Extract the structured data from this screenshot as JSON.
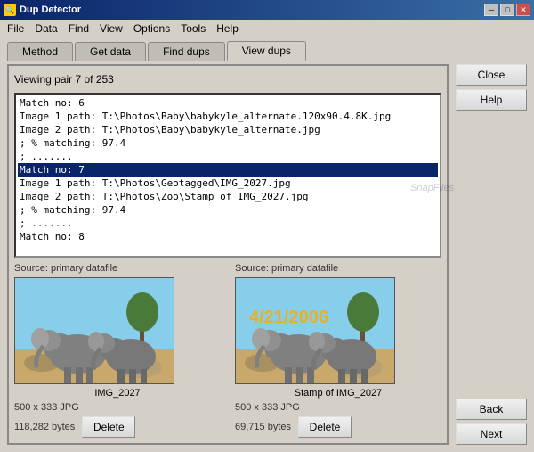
{
  "titleBar": {
    "title": "Dup Detector",
    "icon": "DD",
    "buttons": [
      "minimize",
      "maximize",
      "close"
    ]
  },
  "menuBar": {
    "items": [
      "File",
      "Data",
      "Find",
      "View",
      "Options",
      "Tools",
      "Help"
    ]
  },
  "tabs": [
    {
      "label": "Method",
      "active": false
    },
    {
      "label": "Get data",
      "active": false
    },
    {
      "label": "Find dups",
      "active": false
    },
    {
      "label": "View dups",
      "active": true
    }
  ],
  "rightButtons": {
    "close": "Close",
    "help": "Help",
    "back": "Back",
    "next": "Next"
  },
  "viewingStatus": "Viewing pair 7 of 253",
  "listItems": [
    {
      "text": "Match no: 6",
      "selected": false
    },
    {
      "text": "Image 1 path: T:\\Photos\\Baby\\babykyle_alternate.120x90.4.8K.jpg",
      "selected": false
    },
    {
      "text": "Image 2 path: T:\\Photos\\Baby\\babykyle_alternate.jpg",
      "selected": false
    },
    {
      "text": "; % matching: 97.4",
      "selected": false
    },
    {
      "text": "; .......",
      "selected": false
    },
    {
      "text": "Match no: 7",
      "selected": true
    },
    {
      "text": "Image 1 path: T:\\Photos\\Geotagged\\IMG_2027.jpg",
      "selected": false
    },
    {
      "text": "Image 2 path: T:\\Photos\\Zoo\\Stamp of IMG_2027.jpg",
      "selected": false
    },
    {
      "text": "; % matching: 97.4",
      "selected": false
    },
    {
      "text": "; .......",
      "selected": false
    },
    {
      "text": "Match no: 8",
      "selected": false
    }
  ],
  "image1": {
    "sourceLabel": "Source: primary datafile",
    "name": "IMG_2027",
    "dimensions": "500 x 333 JPG",
    "size": "118,282 bytes",
    "deleteLabel": "Delete"
  },
  "image2": {
    "sourceLabel": "Source: primary datafile",
    "name": "Stamp of IMG_2027",
    "dimensions": "500 x 333 JPG",
    "size": "69,715 bytes",
    "deleteLabel": "Delete",
    "watermarkText": "4/21/2006"
  }
}
